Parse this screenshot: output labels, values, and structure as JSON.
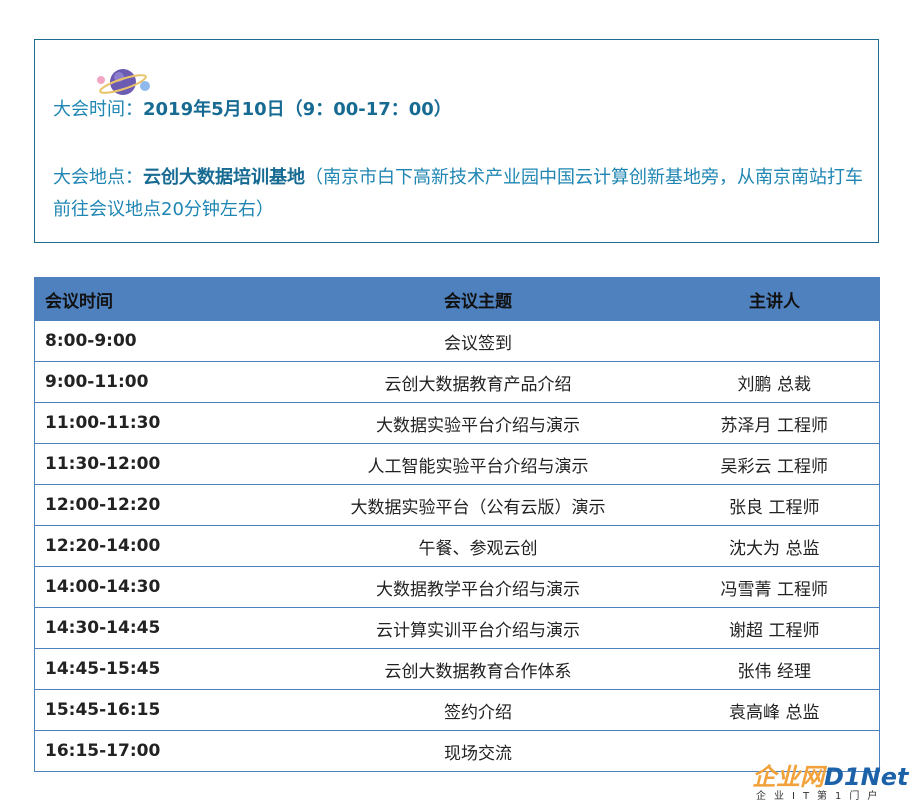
{
  "info": {
    "time_label": "大会时间：",
    "time_value": "2019年5月10日（9：00-17：00）",
    "place_label": "大会地点：",
    "place_value": "云创大数据培训基地",
    "place_note": "（南京市白下高新技术产业园中国云计算创新基地旁，从南京南站打车前往会议地点20分钟左右）"
  },
  "table": {
    "headers": [
      "会议时间",
      "会议主题",
      "主讲人"
    ],
    "rows": [
      [
        "8:00-9:00",
        "会议签到",
        ""
      ],
      [
        "9:00-11:00",
        "云创大数据教育产品介绍",
        "刘鹏 总裁"
      ],
      [
        "11:00-11:30",
        "大数据实验平台介绍与演示",
        "苏泽月 工程师"
      ],
      [
        "11:30-12:00",
        "人工智能实验平台介绍与演示",
        "吴彩云 工程师"
      ],
      [
        "12:00-12:20",
        "大数据实验平台（公有云版）演示",
        "张良 工程师"
      ],
      [
        "12:20-14:00",
        "午餐、参观云创",
        "沈大为 总监"
      ],
      [
        "14:00-14:30",
        "大数据教学平台介绍与演示",
        "冯雪菁 工程师"
      ],
      [
        "14:30-14:45",
        "云计算实训平台介绍与演示",
        "谢超 工程师"
      ],
      [
        "14:45-15:45",
        "云创大数据教育合作体系",
        "张伟 经理"
      ],
      [
        "15:45-16:15",
        "签约介绍",
        "袁高峰 总监"
      ],
      [
        "16:15-17:00",
        "现场交流",
        ""
      ]
    ]
  },
  "logo": {
    "cn": "企业网",
    "d1": "D1",
    "net": "Net",
    "sub": "企业IT第1门户"
  },
  "colors": {
    "accent": "#1f86b3",
    "header_bg": "#4e81bd",
    "border": "#1d6d8f"
  }
}
